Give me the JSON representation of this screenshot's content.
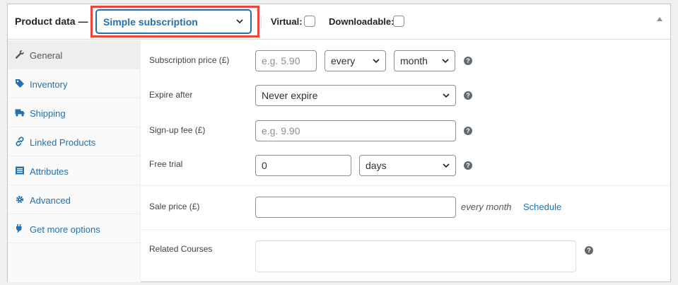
{
  "header": {
    "title": "Product data",
    "dash": "—",
    "product_type": "Simple subscription",
    "virtual_label": "Virtual:",
    "downloadable_label": "Downloadable:"
  },
  "tabs": [
    {
      "label": "General",
      "icon": "wrench-icon"
    },
    {
      "label": "Inventory",
      "icon": "tag-icon"
    },
    {
      "label": "Shipping",
      "icon": "truck-icon"
    },
    {
      "label": "Linked Products",
      "icon": "link-icon"
    },
    {
      "label": "Attributes",
      "icon": "list-icon"
    },
    {
      "label": "Advanced",
      "icon": "gear-icon"
    },
    {
      "label": "Get more options",
      "icon": "plugin-icon"
    }
  ],
  "fields": {
    "subscription_price": {
      "label": "Subscription price (£)",
      "placeholder": "e.g. 5.90",
      "interval": "every",
      "period": "month"
    },
    "expire_after": {
      "label": "Expire after",
      "value": "Never expire"
    },
    "signup_fee": {
      "label": "Sign-up fee (£)",
      "placeholder": "e.g. 9.90"
    },
    "free_trial": {
      "label": "Free trial",
      "value": "0",
      "period": "days"
    },
    "sale_price": {
      "label": "Sale price (£)",
      "value": "",
      "suffix": "every month",
      "schedule": "Schedule"
    },
    "related_courses": {
      "label": "Related Courses",
      "value": ""
    }
  },
  "help_glyph": "?",
  "colors": {
    "accent": "#2271b1",
    "highlight": "#e8473d"
  }
}
